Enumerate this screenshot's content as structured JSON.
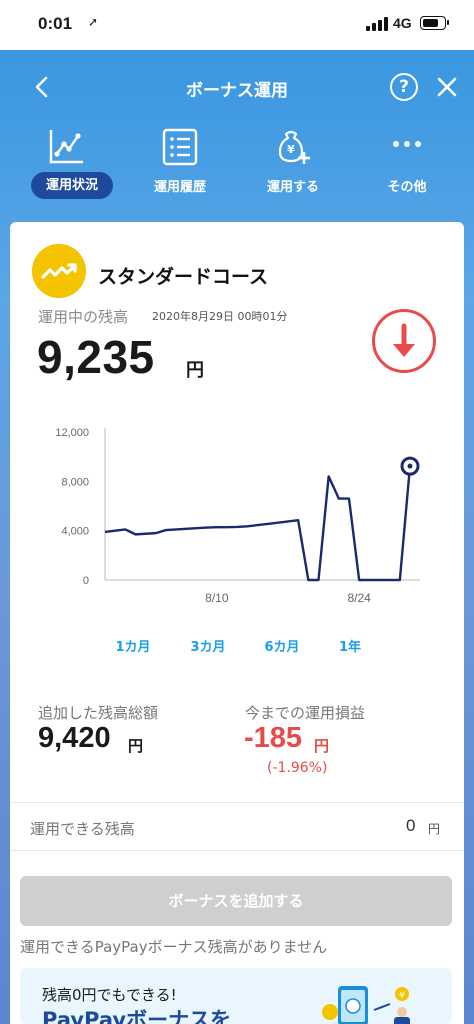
{
  "status_bar": {
    "time": "0:01",
    "network": "4G"
  },
  "header": {
    "title": "ボーナス運用",
    "help_label": "?"
  },
  "tabs": [
    {
      "label": "運用状況",
      "icon": "line-chart-icon",
      "active": true
    },
    {
      "label": "運用履歴",
      "icon": "list-icon",
      "active": false
    },
    {
      "label": "運用する",
      "icon": "yen-bag-plus-icon",
      "active": false
    },
    {
      "label": "その他",
      "icon": "more-dots-icon",
      "active": false
    }
  ],
  "course": {
    "name": "スタンダードコース",
    "icon": "trend-up-icon"
  },
  "balance": {
    "label": "運用中の残高",
    "date": "2020年8月29日 00時01分",
    "value": "9,235",
    "unit": "円",
    "trend": "down-arrow-icon"
  },
  "chart_data": {
    "type": "line",
    "y_ticks": [
      "12,000",
      "8,000",
      "4,000",
      "0"
    ],
    "x_ticks": [
      "8/10",
      "8/24"
    ],
    "ylim": [
      0,
      12000
    ],
    "xlim": [
      "7/30",
      "8/29"
    ],
    "grid": false,
    "color": "#1a2a6c",
    "x": [
      "7/30",
      "7/31",
      "8/1",
      "8/2",
      "8/3",
      "8/4",
      "8/5",
      "8/6",
      "8/7",
      "8/8",
      "8/9",
      "8/10",
      "8/11",
      "8/12",
      "8/13",
      "8/14",
      "8/15",
      "8/16",
      "8/17",
      "8/18",
      "8/19",
      "8/20",
      "8/21",
      "8/22",
      "8/23",
      "8/24",
      "8/25",
      "8/26",
      "8/27",
      "8/28",
      "8/29"
    ],
    "values": [
      3900,
      4000,
      4100,
      3700,
      3750,
      3800,
      4050,
      4100,
      4150,
      4200,
      4250,
      4280,
      4280,
      4300,
      4350,
      4450,
      4550,
      4650,
      4750,
      4850,
      0,
      0,
      8400,
      6600,
      6600,
      0,
      0,
      0,
      0,
      0,
      9235
    ]
  },
  "ranges": [
    "1カ月",
    "3カ月",
    "6カ月",
    "1年"
  ],
  "active_range": 0,
  "added": {
    "label": "追加した残高総額",
    "value": "9,420",
    "unit": "円"
  },
  "profit": {
    "label": "今までの運用損益",
    "value": "-185",
    "unit": "円",
    "percent": "(-1.96%)",
    "color": "#e84b4b"
  },
  "available": {
    "label": "運用できる残高",
    "value": "0",
    "unit": "円"
  },
  "add_button": {
    "label": "ボーナスを追加する"
  },
  "add_note": "運用できるPayPayボーナス残高がありません",
  "promo": {
    "subtitle": "残高0円でもできる!",
    "title": "PayPayボーナスを"
  },
  "colors": {
    "accent": "#18a4ec",
    "negative": "#e84b4b",
    "navy": "#1d4a9c",
    "course_yellow": "#f4c400"
  }
}
